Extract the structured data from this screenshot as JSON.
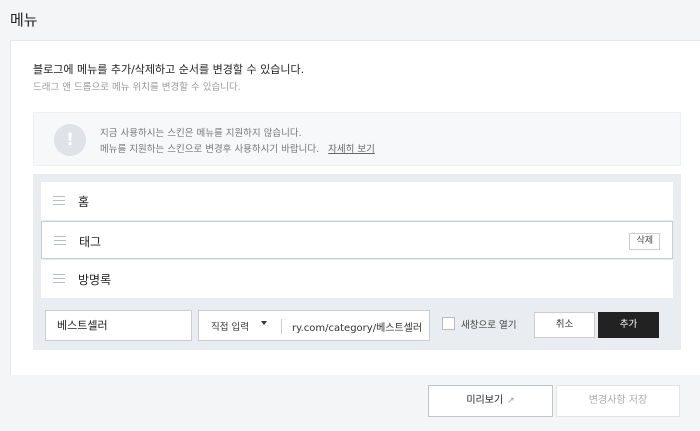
{
  "page": {
    "title": "메뉴"
  },
  "description": {
    "main": "블로그에 메뉴를 추가/삭제하고 순서를 변경할 수 있습니다.",
    "sub": "드래그 앤 드롭으로 메뉴 위치를 변경할 수 있습니다."
  },
  "notice": {
    "icon": "exclamation-icon",
    "line1": "지금 사용하시는 스킨은 메뉴를 지원하지 않습니다.",
    "line2": "메뉴를 지원하는 스킨으로 변경후 사용하시기 바랍니다.",
    "link": "자세히 보기"
  },
  "menu": {
    "items": [
      {
        "label": "홈",
        "selected": false
      },
      {
        "label": "태그",
        "selected": true,
        "action": "삭제"
      },
      {
        "label": "방명록",
        "selected": false
      }
    ]
  },
  "add_form": {
    "name_value": "베스트셀러",
    "type_selected": "직접 입력",
    "url_value": "ry.com/category/베스트셀러",
    "new_window_label": "새창으로 열기",
    "new_window_checked": false,
    "cancel_label": "취소",
    "add_label": "추가"
  },
  "footer": {
    "preview_label": "미리보기",
    "save_label": "변경사항 저장"
  },
  "colors": {
    "primary_button": "#222222",
    "background": "#f4f5f7",
    "menu_area": "#e9ecf0"
  }
}
